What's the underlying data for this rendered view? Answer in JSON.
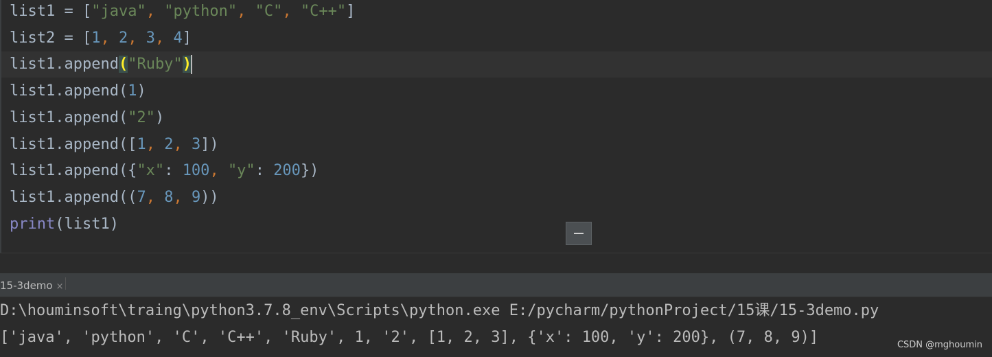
{
  "editor": {
    "lines": [
      {
        "id": "l1",
        "text": "list1 = [\"java\", \"python\", \"C\", \"C++\"]"
      },
      {
        "id": "l2",
        "text": "list2 = [1, 2, 3, 4]"
      },
      {
        "id": "l3",
        "text": "list1.append(\"Ruby\")"
      },
      {
        "id": "l4",
        "text": "list1.append(1)"
      },
      {
        "id": "l5",
        "text": "list1.append(\"2\")"
      },
      {
        "id": "l6",
        "text": "list1.append([1, 2, 3])"
      },
      {
        "id": "l7",
        "text": "list1.append({\"x\": 100, \"y\": 200})"
      },
      {
        "id": "l8",
        "text": "list1.append((7, 8, 9))"
      },
      {
        "id": "l9",
        "text": "print(list1)"
      }
    ]
  },
  "run_panel": {
    "tab_label": "15-3demo",
    "close_glyph": "×"
  },
  "console": {
    "command": "D:\\houminsoft\\traing\\python3.7.8_env\\Scripts\\python.exe E:/pycharm/pythonProject/15课/15-3demo.py",
    "output": "['java', 'python', 'C', 'C++', 'Ruby', 1, '2', [1, 2, 3], {'x': 100, 'y': 200}, (7, 8, 9)]"
  },
  "watermark": "CSDN @mghoumin",
  "colors": {
    "background": "#2b2b2b",
    "text": "#a9b7c6",
    "string": "#6a8759",
    "number": "#6897bb",
    "keyword": "#cc7832",
    "builtin": "#8888c6",
    "brace_match": "#ffef28"
  },
  "icons": {
    "fold": "minus-icon",
    "close": "close-icon"
  }
}
